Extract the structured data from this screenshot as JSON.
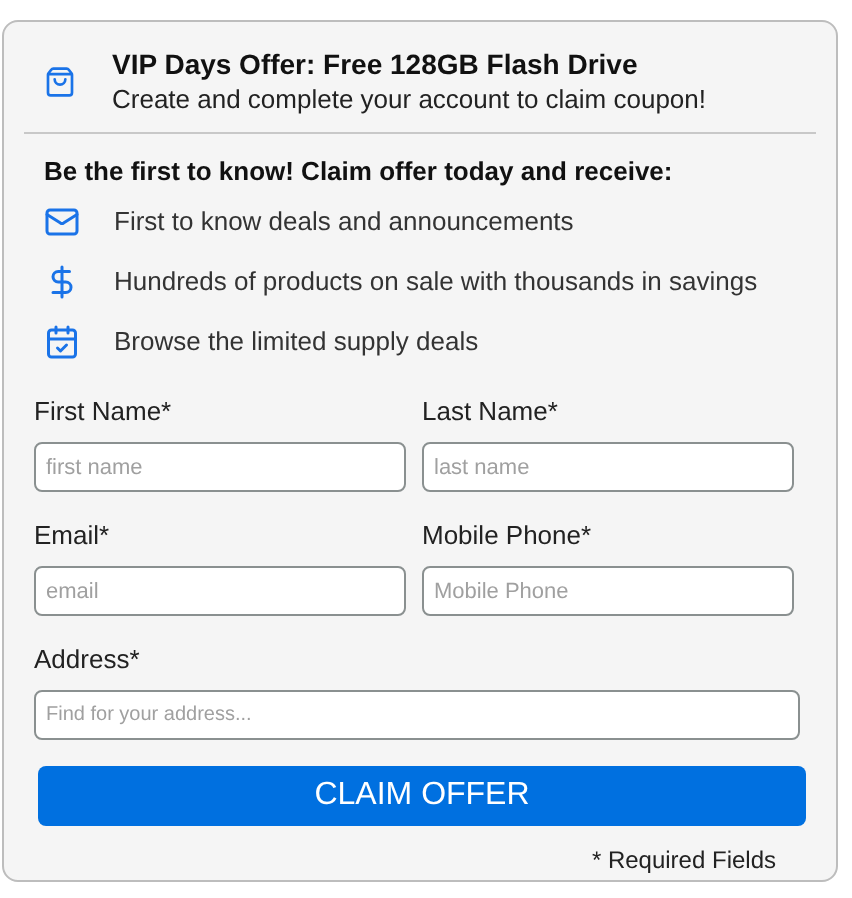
{
  "offer": {
    "title": "VIP Days Offer: Free 128GB Flash Drive",
    "subtitle": "Create and complete your account to claim coupon!"
  },
  "benefits_heading": "Be the first to know! Claim offer today and receive:",
  "benefits": [
    {
      "kind": "mail",
      "text": "First to know deals and announcements"
    },
    {
      "kind": "dollar",
      "text": "Hundreds of products on sale with thousands in savings"
    },
    {
      "kind": "calendar",
      "text": "Browse the limited supply deals"
    }
  ],
  "fields": [
    {
      "label": "First Name*",
      "placeholder": "first name"
    },
    {
      "label": "Last Name*",
      "placeholder": "last name"
    },
    {
      "label": "Email*",
      "placeholder": "email"
    },
    {
      "label": "Mobile Phone*",
      "placeholder": "Mobile Phone"
    },
    {
      "label": "Address*",
      "placeholder": "Find for your address..."
    }
  ],
  "submit": "CLAIM OFFER",
  "required_note": "* Required Fields"
}
